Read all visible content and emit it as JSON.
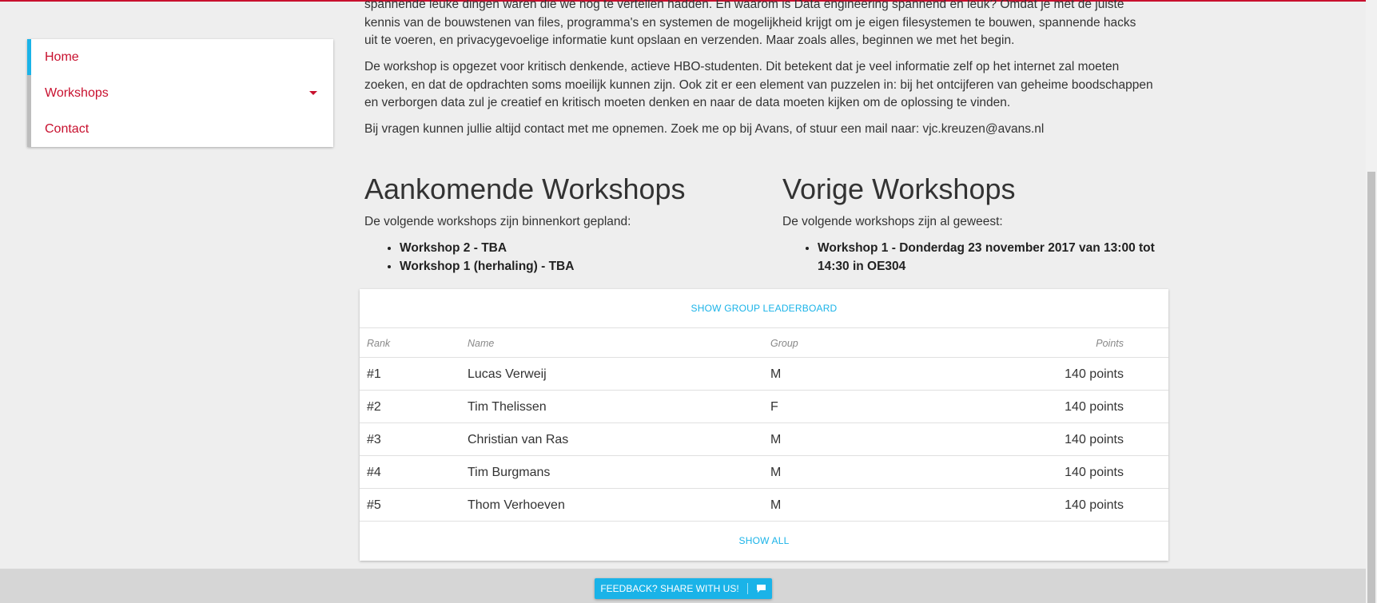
{
  "sidebar": {
    "items": [
      {
        "label": "Home"
      },
      {
        "label": "Workshops"
      },
      {
        "label": "Contact"
      }
    ]
  },
  "intro": {
    "p1_line1": "spannende leuke dingen waren die we nog te vertellen hadden. En waarom is Data engineering spannend en leuk? Omdat je met de juiste",
    "p1_line2": "kennis van de bouwstenen van files, programma's en systemen de mogelijkheid krijgt om je eigen filesystemen te bouwen, spannende hacks",
    "p1_line3": "uit te voeren, en privacygevoelige informatie kunt opslaan en verzenden. Maar zoals alles, beginnen we met het begin.",
    "p2": "De workshop is opgezet voor kritisch denkende, actieve HBO-studenten. Dit betekent dat je veel informatie zelf op het internet zal moeten zoeken, en dat de opdrachten soms moeilijk kunnen zijn. Ook zit er een element van puzzelen in: bij het ontcijferen van geheime boodschappen en verborgen data zul je creatief en kritisch moeten denken en naar de data moeten kijken om de oplossing te vinden.",
    "p3": "Bij vragen kunnen jullie altijd contact met me opnemen. Zoek me op bij Avans, of stuur een mail naar: vjc.kreuzen@avans.nl"
  },
  "upcoming": {
    "title": "Aankomende Workshops",
    "subtitle": "De volgende workshops zijn binnenkort gepland:",
    "items": [
      "Workshop 2 - TBA",
      "Workshop 1 (herhaling) - TBA"
    ]
  },
  "previous": {
    "title": "Vorige Workshops",
    "subtitle": "De volgende workshops zijn al geweest:",
    "items": [
      "Workshop 1 - Donderdag 23 november 2017 van 13:00 tot 14:30 in OE304"
    ]
  },
  "leaderboard": {
    "group_link": "SHOW GROUP LEADERBOARD",
    "headers": {
      "rank": "Rank",
      "name": "Name",
      "group": "Group",
      "points": "Points"
    },
    "rows": [
      {
        "rank": "#1",
        "name": "Lucas Verweij",
        "group": "M",
        "points": "140 points"
      },
      {
        "rank": "#2",
        "name": "Tim Thelissen",
        "group": "F",
        "points": "140 points"
      },
      {
        "rank": "#3",
        "name": "Christian van Ras",
        "group": "M",
        "points": "140 points"
      },
      {
        "rank": "#4",
        "name": "Tim Burgmans",
        "group": "M",
        "points": "140 points"
      },
      {
        "rank": "#5",
        "name": "Thom Verhoeven",
        "group": "M",
        "points": "140 points"
      }
    ],
    "show_all": "SHOW ALL"
  },
  "footer": {
    "feedback_label": "FEEDBACK? SHARE WITH US!",
    "icon": "chat-bubble-icon"
  },
  "colors": {
    "accent_red": "#c8102e",
    "accent_blue": "#1ab3e8"
  }
}
